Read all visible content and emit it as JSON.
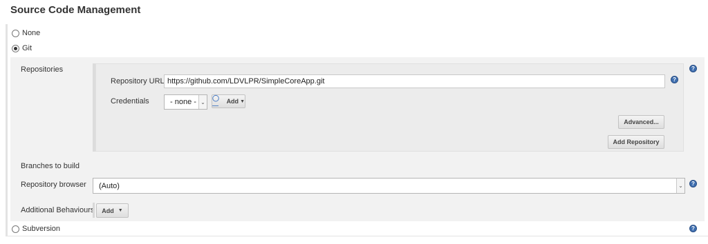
{
  "section": {
    "title": "Source Code Management"
  },
  "scm_options": {
    "none": "None",
    "git": "Git",
    "subversion": "Subversion",
    "selected": "Git"
  },
  "repositories": {
    "label": "Repositories",
    "url_label": "Repository URL",
    "url_value": "https://github.com/LDVLPR/SimpleCoreApp.git",
    "credentials_label": "Credentials",
    "credentials_value": "- none -",
    "add_credentials_label": "Add",
    "advanced_label": "Advanced...",
    "add_repository_label": "Add Repository"
  },
  "branches": {
    "label": "Branches to build"
  },
  "repo_browser": {
    "label": "Repository browser",
    "value": "(Auto)"
  },
  "additional_behaviours": {
    "label": "Additional Behaviours",
    "add_label": "Add"
  },
  "icons": {
    "help": "help-icon",
    "key": "key-icon",
    "dropdown": "chevron-down-icon"
  },
  "colors": {
    "help_icon": "#3f6fb0",
    "panel_bg": "#f2f2f2"
  }
}
